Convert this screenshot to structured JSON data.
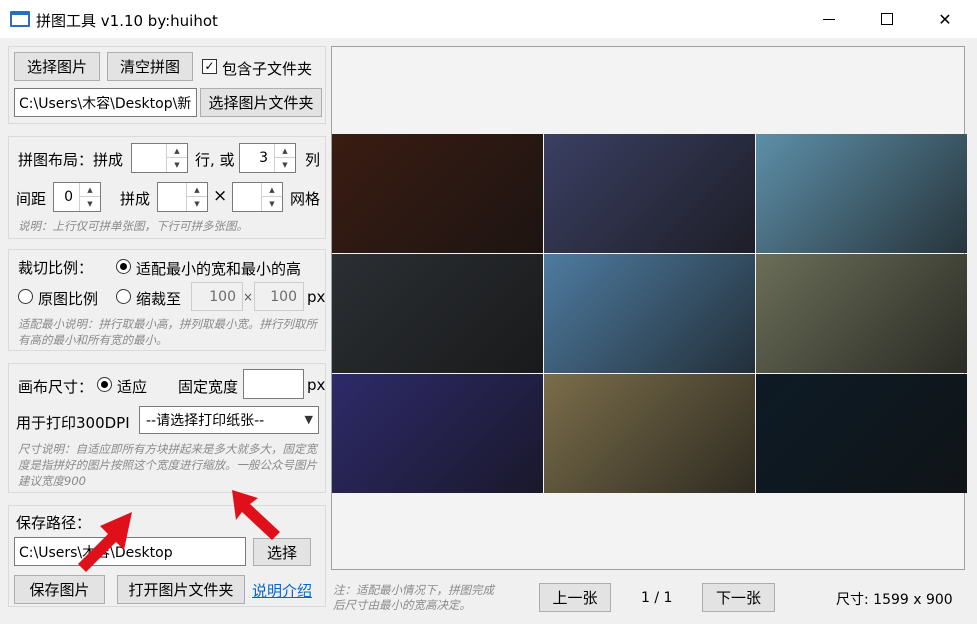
{
  "window": {
    "title": "拼图工具 v1.10 by:huihot",
    "minimize": "—",
    "maximize": "☐",
    "close": "✕"
  },
  "files": {
    "select_images": "选择图片",
    "clear": "清空拼图",
    "include_subfolders": "包含子文件夹",
    "include_subfolders_checked": true,
    "folder_path": "C:\\Users\\木容\\Desktop\\新",
    "select_folder": "选择图片文件夹"
  },
  "layout": {
    "label": "拼图布局：拼成",
    "rows_value": "",
    "rows_suffix": "行, 或",
    "cols_value": "3",
    "cols_suffix": "列",
    "spacing_label": "间距",
    "spacing_value": "0",
    "grid_label": "拼成",
    "grid_a": "",
    "times": "×",
    "grid_b": "",
    "grid_suffix": "网格",
    "hint": "说明：上行仅可拼单张图，下行可拼多张图。"
  },
  "crop": {
    "label": "裁切比例：",
    "opt_fit": "适配最小的宽和最小的高",
    "opt_original": "原图比例",
    "opt_scale": "缩裁至",
    "selected": "fit",
    "width": "100",
    "times": "×",
    "height": "100",
    "unit": "px",
    "hint": "适配最小说明：拼行取最小高，拼列取最小宽。拼行列取所有高的最小和所有宽的最小。"
  },
  "canvas": {
    "label": "画布尺寸：",
    "opt_auto": "适应",
    "fixed_label": "固定宽度",
    "fixed_value": "",
    "unit": "px",
    "print_label": "用于打印300DPI",
    "print_select": "--请选择打印纸张--",
    "hint": "尺寸说明：自适应即所有方块拼起来是多大就多大，固定宽度是指拼好的图片按照这个宽度进行缩放。一般公众号图片建议宽度900"
  },
  "save": {
    "label": "保存路径：",
    "path": "C:\\Users\\木容\\Desktop",
    "choose": "选择",
    "save_image": "保存图片",
    "open_folder": "打开图片文件夹",
    "help": "说明介绍"
  },
  "footer": {
    "note_line1": "注：适配最小情况下，拼图完成",
    "note_line2": "后尺寸由最小的宽高决定。",
    "prev": "上一张",
    "page": "1 / 1",
    "next": "下一张",
    "size": "尺寸: 1599 x 900"
  },
  "preview": {
    "tiles": [
      {
        "name": "tile-dark-hair-man",
        "bg": "#3a1c12"
      },
      {
        "name": "tile-girl-car-city",
        "bg": "#3b3f62"
      },
      {
        "name": "tile-water-fairy",
        "bg": "#5d8fa8"
      },
      {
        "name": "tile-misty-door",
        "bg": "#2b2f33"
      },
      {
        "name": "tile-valley-couple",
        "bg": "#4e7ba0"
      },
      {
        "name": "tile-garden-girls",
        "bg": "#6b6e58"
      },
      {
        "name": "tile-blue-hair-girl",
        "bg": "#2e2a6a"
      },
      {
        "name": "tile-taxi-scene",
        "bg": "#7a6d4a"
      },
      {
        "name": "tile-blue-flame-warrior",
        "bg": "#0d1b26"
      }
    ]
  }
}
